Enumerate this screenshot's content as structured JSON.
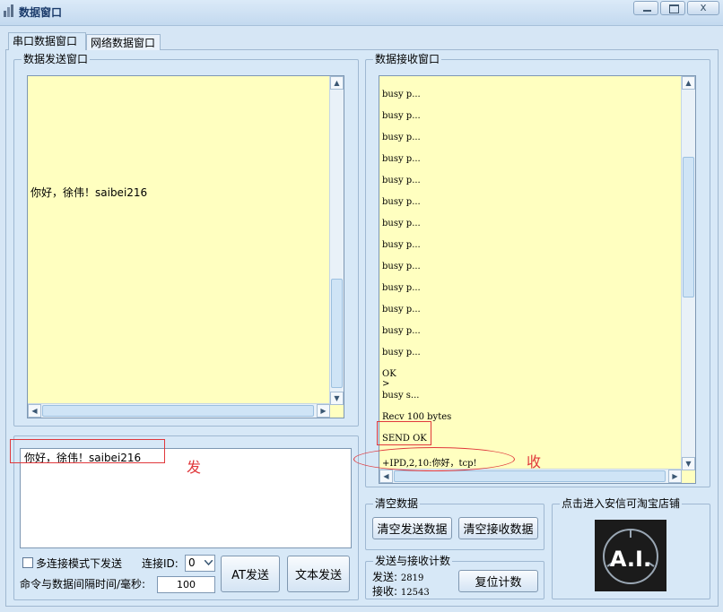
{
  "window": {
    "title": "数据窗口",
    "min_icon": "minimize-icon",
    "max_icon": "maximize-icon",
    "close_glyph": "x"
  },
  "tabs": [
    {
      "label": "串口数据窗口",
      "active": true
    },
    {
      "label": "网络数据窗口",
      "active": false
    }
  ],
  "send_window": {
    "title": "数据发送窗口",
    "content": "你好，徐伟！saibei216"
  },
  "receive_window": {
    "title": "数据接收窗口",
    "lines": [
      "busy p...",
      "busy p...",
      "busy p...",
      "busy p...",
      "busy p...",
      "busy p...",
      "busy p...",
      "busy p...",
      "busy p...",
      "busy p...",
      "busy p...",
      "busy p...",
      "busy p...",
      "OK",
      ">",
      "busy s...",
      "Recv 100 bytes",
      "SEND OK",
      "+IPD,2,10:你好，tcp!"
    ]
  },
  "input_box": {
    "value": "你好，徐伟！saibei216"
  },
  "annotations": {
    "send_label": "发",
    "receive_label": "收"
  },
  "controls": {
    "multi_connect_label": "多连接模式下发送",
    "multi_connect_checked": false,
    "connection_id_label": "连接ID:",
    "connection_id_value": "0",
    "interval_label": "命令与数据间隔时间/毫秒:",
    "interval_value": "100",
    "at_send_button": "AT发送",
    "text_send_button": "文本发送"
  },
  "clear_group": {
    "title": "清空数据",
    "clear_send_button": "清空发送数据",
    "clear_receive_button": "清空接收数据"
  },
  "counter_group": {
    "title": "发送与接收计数",
    "sent_label": "发送:",
    "sent_value": "2819",
    "received_label": "接收:",
    "received_value": "12543",
    "reset_button": "复位计数"
  },
  "shop_group": {
    "title": "点击进入安信可淘宝店铺",
    "logo_text": "A.I."
  },
  "colors": {
    "text_area_bg": "#ffffc0",
    "window_bg": "#d7e8f7",
    "annotation_red": "#e0383c",
    "logo_bg": "#1b1b1b"
  }
}
